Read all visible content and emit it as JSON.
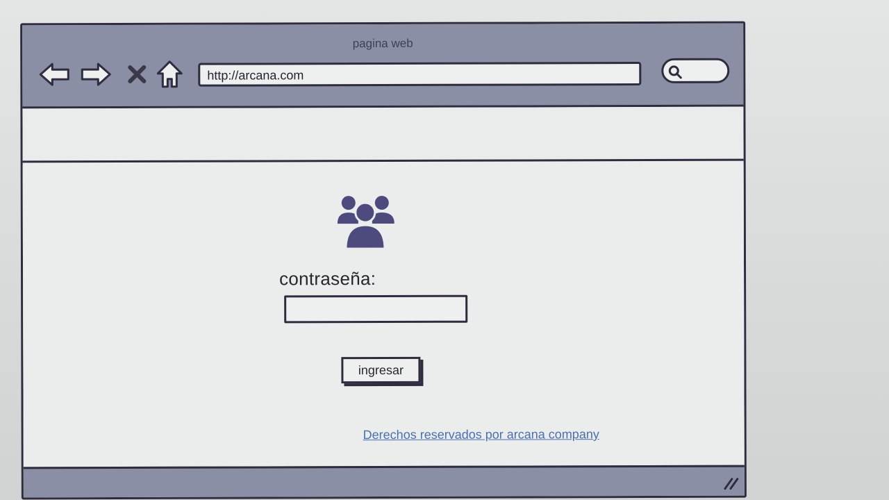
{
  "window": {
    "title": "pagina web"
  },
  "navigation": {
    "back_icon": "arrow-left-icon",
    "forward_icon": "arrow-right-icon",
    "stop_icon": "close-icon",
    "home_icon": "home-icon"
  },
  "address_bar": {
    "url": "http://arcana.com"
  },
  "search": {
    "icon": "search-icon",
    "value": ""
  },
  "login": {
    "icon": "users-icon",
    "password_label": "contraseña:",
    "password_value": "",
    "submit_label": "ingresar"
  },
  "footer": {
    "link_text": "Derechos reservados por arcana company"
  },
  "colors": {
    "chrome": "#8a8fa6",
    "outline": "#2e2c3e",
    "icon": "#4d4a7d",
    "link": "#4a6fb0"
  }
}
